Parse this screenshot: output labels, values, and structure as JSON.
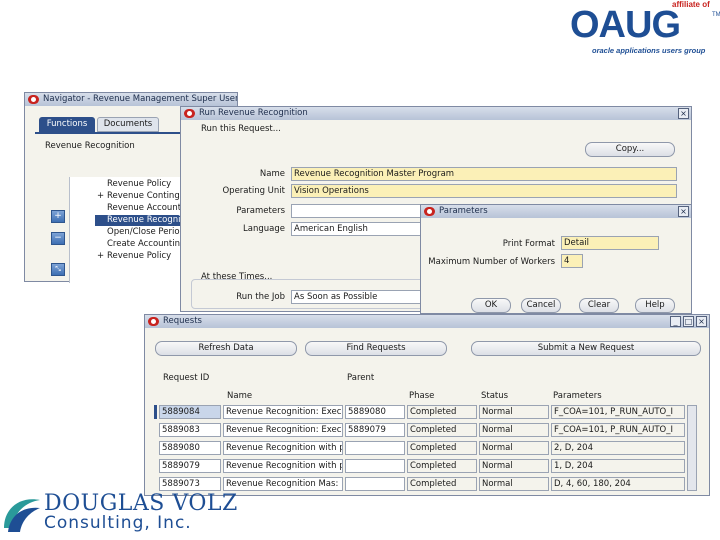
{
  "oaug": {
    "affiliate": "affiliate of",
    "word": "OAUG",
    "tagline": "oracle applications users group",
    "tm": "TM"
  },
  "navigator": {
    "title": "Navigator - Revenue Management Super User, V",
    "tabs": [
      "Functions",
      "Documents"
    ],
    "heading": "Revenue Recognition",
    "items": [
      {
        "prefix": "",
        "label": "Revenue Policy"
      },
      {
        "prefix": "+",
        "label": "Revenue Contingencies"
      },
      {
        "prefix": "",
        "label": "Revenue Accounting"
      },
      {
        "prefix": "",
        "label": "Revenue Recognition"
      },
      {
        "prefix": "",
        "label": "Open/Close Periods"
      },
      {
        "prefix": "",
        "label": "Create Accounting"
      },
      {
        "prefix": "+",
        "label": "Revenue Policy"
      }
    ],
    "selected_index": 3
  },
  "run_window": {
    "title": "Run Revenue Recognition",
    "section_label": "Run this Request...",
    "copy_button": "Copy...",
    "name_label": "Name",
    "name_value": "Revenue Recognition Master Program",
    "ou_label": "Operating Unit",
    "ou_value": "Vision Operations",
    "params_label": "Parameters",
    "lang_label": "Language",
    "lang_value": "American English",
    "at_these_times": "At these Times...",
    "run_job_label": "Run the Job",
    "run_job_value": "As Soon as Possible"
  },
  "parameters_dialog": {
    "title": "Parameters",
    "print_format_label": "Print Format",
    "print_format_value": "Detail",
    "max_workers_label": "Maximum Number of Workers",
    "max_workers_value": "4",
    "buttons": [
      "OK",
      "Cancel",
      "Clear",
      "Help"
    ]
  },
  "requests": {
    "title": "Requests",
    "refresh_button": "Refresh Data",
    "find_button": "Find Requests",
    "submit_button": "Submit a New Request",
    "headers": {
      "request_id": "Request ID",
      "name": "Name",
      "parent": "Parent",
      "phase": "Phase",
      "status": "Status",
      "parameters": "Parameters"
    },
    "rows": [
      {
        "id": "5889084",
        "name": "Revenue Recognition: Exec",
        "parent": "5889080",
        "phase": "Completed",
        "status": "Normal",
        "params": "F_COA=101, P_RUN_AUTO_I"
      },
      {
        "id": "5889083",
        "name": "Revenue Recognition: Exec",
        "parent": "5889079",
        "phase": "Completed",
        "status": "Normal",
        "params": "F_COA=101, P_RUN_AUTO_I"
      },
      {
        "id": "5889080",
        "name": "Revenue Recognition with p",
        "parent": "",
        "phase": "Completed",
        "status": "Normal",
        "params": "2, D, 204"
      },
      {
        "id": "5889079",
        "name": "Revenue Recognition with p",
        "parent": "",
        "phase": "Completed",
        "status": "Normal",
        "params": "1, D, 204"
      },
      {
        "id": "5889073",
        "name": "Revenue Recognition Mas:",
        "parent": "",
        "phase": "Completed",
        "status": "Normal",
        "params": "D, 4, 60, 180, 204"
      }
    ]
  },
  "douglas_volz": {
    "name": "DOUGLAS VOLZ",
    "sub": "Consulting, Inc."
  },
  "colors": {
    "oracle_red": "#c8231f",
    "logo_blue": "#1e4e94",
    "required_field": "#fbf0b7",
    "selection": "#2d4f8a"
  }
}
